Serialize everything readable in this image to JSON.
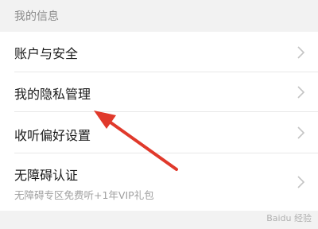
{
  "section": {
    "title": "我的信息"
  },
  "items": [
    {
      "label": "账户与安全"
    },
    {
      "label": "我的隐私管理"
    },
    {
      "label": "收听偏好设置"
    },
    {
      "label": "无障碍认证",
      "subtitle": "无障碍专区免费听+1年VIP礼包"
    }
  ],
  "watermark": "Baidu 经验",
  "colors": {
    "arrow": "#e0392b",
    "chevron": "#c4c4c4"
  }
}
